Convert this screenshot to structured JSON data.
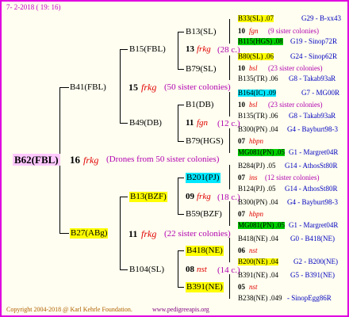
{
  "header": {
    "date": "7- 2-2018 ( 19: 16)"
  },
  "root": {
    "name": "B62(FBL)",
    "num": "16",
    "frkg": "frkg",
    "note": "(Drones from 50 sister colonies)"
  },
  "f1": {
    "name": "B41(FBL)",
    "num": "15",
    "frkg": "frkg",
    "note": "(50 sister colonies)"
  },
  "m1": {
    "name": "B27(ABg)",
    "num": "11",
    "frkg": "frkg",
    "note": "(22 sister colonies)"
  },
  "ff": {
    "name": "B15(FBL)",
    "num": "13",
    "frkg": "frkg",
    "note": "(28 c.)"
  },
  "fm": {
    "name": "B49(DB)",
    "num": "11",
    "frkg": "fgn",
    "note": "(12 c.)"
  },
  "mf": {
    "name": "B13(BZF)",
    "num": "09",
    "frkg": "frkg",
    "note": "(18 c.)"
  },
  "mm": {
    "name": "B104(SL)",
    "num": "08",
    "frkg": "nst",
    "note": "(14 c.)"
  },
  "g3": [
    {
      "name": "B13(SL)",
      "num": "10",
      "sub": "fgn",
      "note": "(9 sister colonies)",
      "top": {
        "name": "B33(SL) .07",
        "right": "G29 - B-xx43",
        "hl": "y"
      },
      "bot": {
        "name": "B115(HGS) .08",
        "right": "G19 - Sinop72R",
        "hl": "g"
      }
    },
    {
      "name": "B79(SL)",
      "num": "10",
      "sub": "bsl",
      "note": "(23 sister colonies)",
      "top": {
        "name": "B80(SL) .06",
        "right": "G24 - Sinop62R",
        "hl": "y"
      },
      "bot": {
        "name": "B135(TR) .06",
        "right": "G8 - Takab93aR",
        "hl": ""
      }
    },
    {
      "name": "B1(DB)",
      "num": "10",
      "sub": "bsl",
      "note": "(23 sister colonies)",
      "top": {
        "name": "B164(IC) .09",
        "right": "G7 - MG00R",
        "hl": "c"
      },
      "bot": {
        "name": "B135(TR) .06",
        "right": "G8 - Takab93aR",
        "hl": ""
      }
    },
    {
      "name": "B79(HGS)",
      "num": "07",
      "sub": "hbpn",
      "note": "",
      "top": {
        "name": "B300(PN) .04",
        "right": "G4 - Bayburt98-3",
        "hl": ""
      },
      "bot": {
        "name": "MG081(PN) .05",
        "right": "G1 - Margret04R",
        "hl": "g"
      }
    },
    {
      "name": "B201(PJ)",
      "num": "07",
      "sub": "ins",
      "note": "(12 sister colonies)",
      "top": {
        "name": "B284(PJ) .05",
        "right": "G14 - AthosSt80R",
        "hl": ""
      },
      "bot": {
        "name": "B124(PJ) .05",
        "right": "G14 - AthosSt80R",
        "hl": ""
      }
    },
    {
      "name": "B59(BZF)",
      "num": "07",
      "sub": "hbpn",
      "note": "",
      "top": {
        "name": "B300(PN) .04",
        "right": "G4 - Bayburt98-3",
        "hl": ""
      },
      "bot": {
        "name": "MG081(PN) .05",
        "right": "G1 - Margret04R",
        "hl": "g"
      }
    },
    {
      "name": "B418(NE)",
      "num": "06",
      "sub": "nst",
      "note": "",
      "top": {
        "name": "B418(NE) .04",
        "right": "G0 - B418(NE)",
        "hl": ""
      },
      "bot": {
        "name": "B200(NE) .04",
        "right": "G2 - B200(NE)",
        "hl": "y"
      }
    },
    {
      "name": "B391(NE)",
      "num": "05",
      "sub": "nst",
      "note": "",
      "top": {
        "name": "B391(NE) .04",
        "right": "G5 - B391(NE)",
        "hl": ""
      },
      "bot": {
        "name": "B238(NE) .049",
        "right": "- SinopEgg86R",
        "hl": ""
      }
    }
  ],
  "footer": {
    "credit": "Copyright 2004-2018 @ Karl Kehrle Foundation.",
    "url": "www.pedigreeapis.org"
  }
}
